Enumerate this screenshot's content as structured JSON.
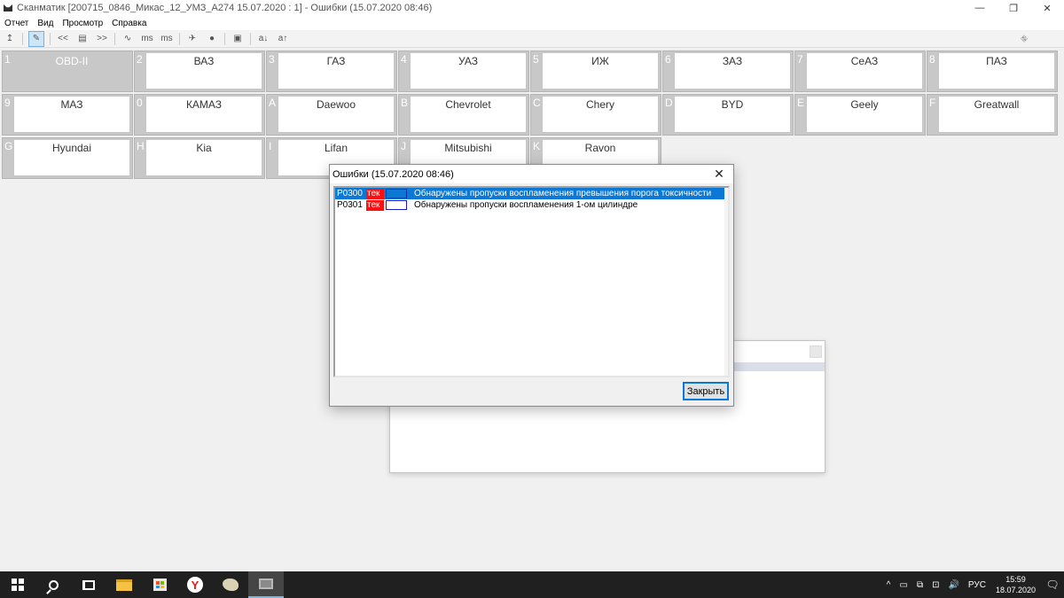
{
  "window": {
    "title": "Сканматик [200715_0846_Микас_12_УМЗ_А274 15.07.2020 : 1] - Ошибки (15.07.2020  08:46)",
    "controls": [
      "—",
      "❐",
      "✕"
    ]
  },
  "menu": [
    "Отчет",
    "Вид",
    "Просмотр",
    "Справка"
  ],
  "toolbar": {
    "buttons": [
      "↥",
      "✎",
      "<<",
      "▤",
      ">>",
      "∿",
      "ms",
      "ms",
      "✈",
      "●",
      "▣",
      "a↓",
      "a↑"
    ],
    "right_icon": "⛗"
  },
  "brands": [
    {
      "key": "1",
      "name": "OBD-II",
      "selected": true
    },
    {
      "key": "2",
      "name": "ВАЗ"
    },
    {
      "key": "3",
      "name": "ГАЗ"
    },
    {
      "key": "4",
      "name": "УАЗ"
    },
    {
      "key": "5",
      "name": "ИЖ"
    },
    {
      "key": "6",
      "name": "ЗАЗ"
    },
    {
      "key": "7",
      "name": "СеАЗ"
    },
    {
      "key": "8",
      "name": "ПАЗ"
    },
    {
      "key": "9",
      "name": "МАЗ"
    },
    {
      "key": "0",
      "name": "КАМАЗ"
    },
    {
      "key": "A",
      "name": "Daewoo"
    },
    {
      "key": "B",
      "name": "Chevrolet"
    },
    {
      "key": "C",
      "name": "Chery"
    },
    {
      "key": "D",
      "name": "BYD"
    },
    {
      "key": "E",
      "name": "Geely"
    },
    {
      "key": "F",
      "name": "Greatwall"
    },
    {
      "key": "G",
      "name": "Hyundai"
    },
    {
      "key": "H",
      "name": "Kia"
    },
    {
      "key": "I",
      "name": "Lifan"
    },
    {
      "key": "J",
      "name": "Mitsubishi"
    },
    {
      "key": "K",
      "name": "Ravon"
    }
  ],
  "dialog": {
    "title": "Ошибки (15.07.2020  08:46)",
    "close_label": "✕",
    "errors": [
      {
        "code": "P0300",
        "tag": "тек",
        "description": "Обнаружены пропуски воспламенения превышения порога токсичности",
        "selected": true
      },
      {
        "code": "P0301",
        "tag": "тек",
        "description": "Обнаружены пропуски воспламенения 1-ом цилиндре",
        "selected": false
      }
    ],
    "ok_label": "Закрыть"
  },
  "taskbar": {
    "tray_icons": [
      "^",
      "▭",
      "⧉",
      "⊡",
      "🔊"
    ],
    "language": "РУС",
    "time": "15:59",
    "date": "18.07.2020",
    "notification_icon": "🗨"
  },
  "colors": {
    "selection": "#0a78d4",
    "error_tag": "#ff1010",
    "taskbar": "#202020"
  }
}
